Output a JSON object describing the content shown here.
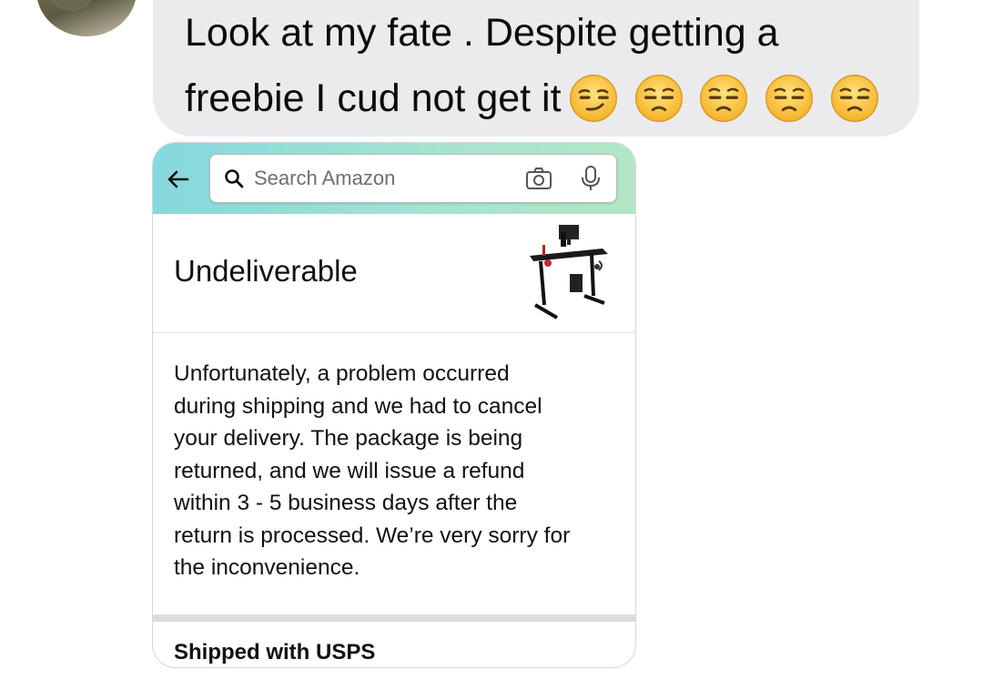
{
  "chat": {
    "message_lines": [
      "Look at my fate . Despite getting a",
      "freebie I cud not get it"
    ],
    "emoji_names": [
      "smirking-face",
      "unamused-face",
      "unamused-face",
      "unamused-face",
      "unamused-face"
    ],
    "bubble_color": "#ebebee"
  },
  "shared_screenshot": {
    "search": {
      "placeholder": "Search Amazon"
    },
    "header_colors": [
      "#86d8dc",
      "#b3e6c6"
    ],
    "icons": [
      "back-arrow-icon",
      "search-icon",
      "camera-icon",
      "microphone-icon"
    ],
    "status": {
      "title": "Undeliverable"
    },
    "message_lines": [
      "Unfortunately, a problem occurred",
      "during shipping and we had to cancel",
      "your delivery. The package is being",
      "returned, and we will issue a refund",
      "within 3 - 5 business days after the",
      "return is processed. We’re very sorry for",
      "the inconvenience."
    ],
    "shipping": {
      "label": "Shipped with USPS"
    }
  }
}
